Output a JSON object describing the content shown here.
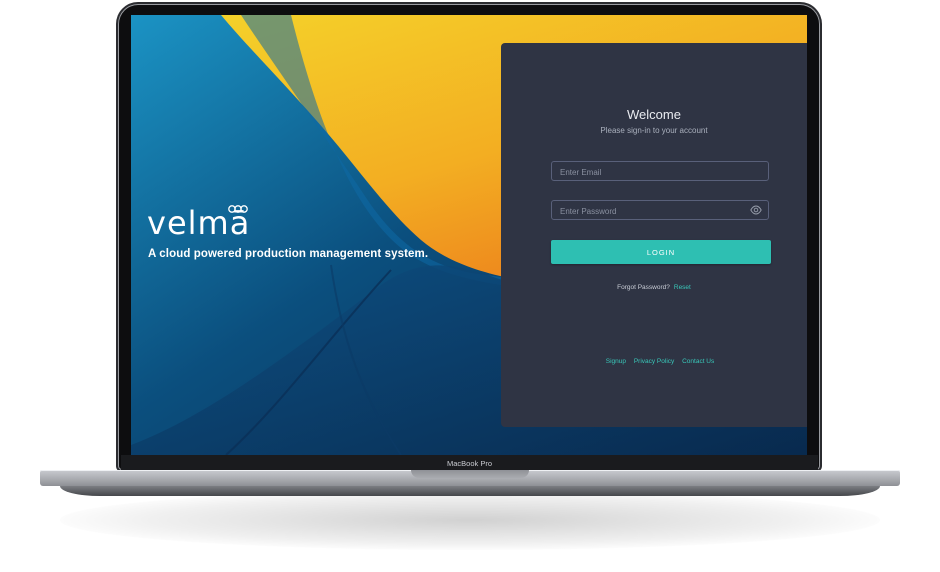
{
  "device": {
    "model_label": "MacBook Pro"
  },
  "brand": {
    "name": "velmā",
    "tagline": "A cloud powered production management system."
  },
  "login": {
    "title": "Welcome",
    "subtitle": "Please sign-in to your account",
    "email_placeholder": "Enter Email",
    "password_placeholder": "Enter Password",
    "button_label": "LOGIN",
    "forgot_text": "Forgot Password?",
    "reset_label": "Reset"
  },
  "footer": {
    "links": [
      "Signup",
      "Privacy Policy",
      "Contact Us"
    ]
  },
  "icons": {
    "password_toggle": "eye-icon",
    "brand_mark": "infinity-icon"
  },
  "colors": {
    "panel": "#2f3444",
    "accent": "#2ebfb2",
    "link": "#39c7b9",
    "wallpaper_yellow": "#f2c11b",
    "wallpaper_blue": "#0b3e6b"
  }
}
